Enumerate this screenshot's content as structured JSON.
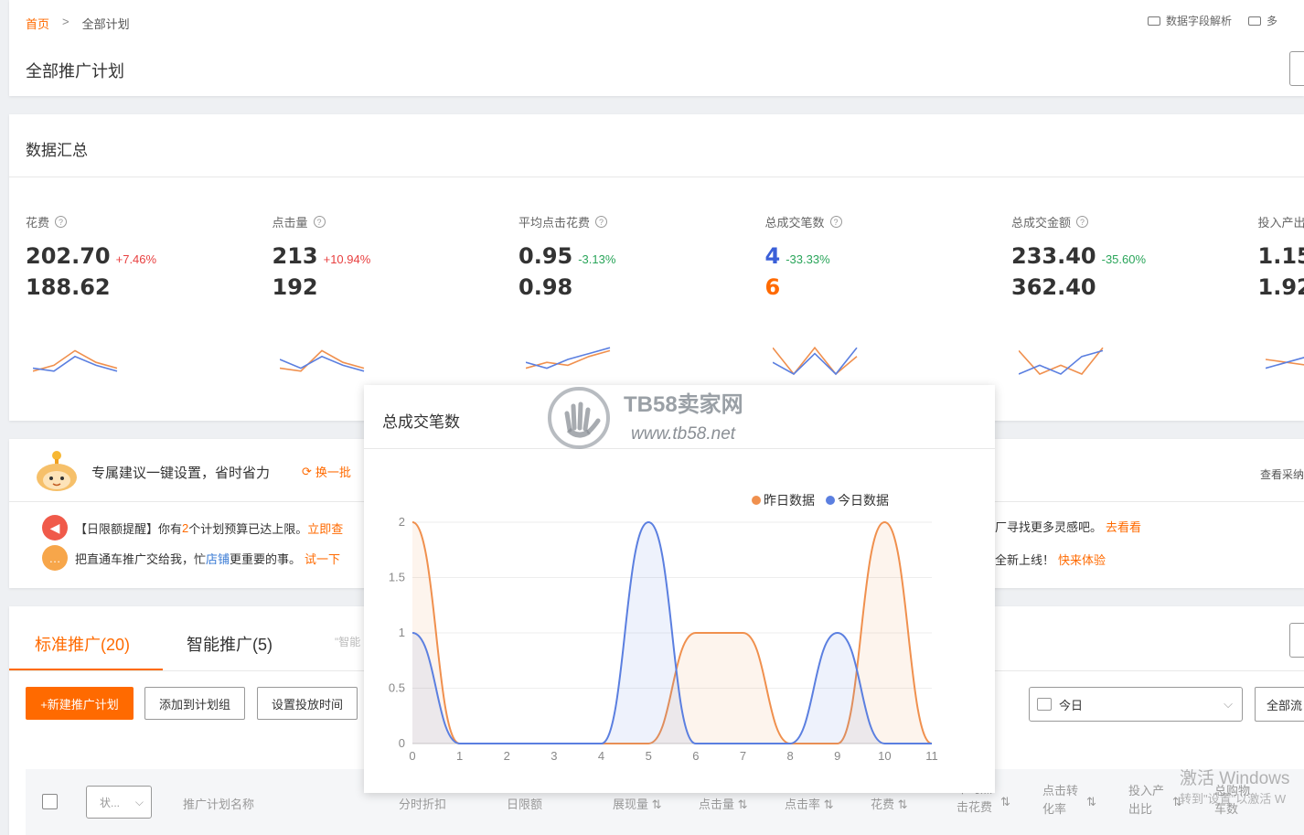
{
  "breadcrumb": {
    "home": "首页",
    "sep": ">",
    "current": "全部计划"
  },
  "top_right": {
    "field_parse": "数据字段解析",
    "multi": "多"
  },
  "page_title": "全部推广计划",
  "summary": {
    "title": "数据汇总",
    "metrics": [
      {
        "label": "花费",
        "today": "202.70",
        "change": "+7.46%",
        "dir": "up",
        "yesterday": "188.62",
        "highlight": false
      },
      {
        "label": "点击量",
        "today": "213",
        "change": "+10.94%",
        "dir": "up",
        "yesterday": "192",
        "highlight": false
      },
      {
        "label": "平均点击花费",
        "today": "0.95",
        "change": "-3.13%",
        "dir": "down",
        "yesterday": "0.98",
        "highlight": false
      },
      {
        "label": "总成交笔数",
        "today": "4",
        "change": "-33.33%",
        "dir": "down",
        "yesterday": "6",
        "highlight": true
      },
      {
        "label": "总成交金额",
        "today": "233.40",
        "change": "-35.60%",
        "dir": "down",
        "yesterday": "362.40",
        "highlight": false
      },
      {
        "label": "投入产出",
        "today": "1.15",
        "change": "",
        "dir": "",
        "yesterday": "1.92",
        "highlight": false
      }
    ]
  },
  "suggest": {
    "title": "专属建议一键设置，省时省力",
    "refresh": "换一批",
    "view_all": "查看采纳",
    "tip1_prefix": "【日限额提醒】你有",
    "tip1_count": "2",
    "tip1_suffix": "个计划预算已达上限。",
    "tip1_link": "立即查",
    "tip2_prefix": "把直通车推广交给我，忙",
    "tip2_shop": "店铺",
    "tip2_suffix": "更重要的事。",
    "tip2_link": "试一下",
    "tip3_text": "厂寻找更多灵感吧。",
    "tip3_link": "去看看",
    "tip4_text": "全新上线！",
    "tip4_link": "快来体验"
  },
  "tabs": {
    "standard": "标准推广(20)",
    "smart": "智能推广(5)",
    "smart_hint": "\"智能"
  },
  "actions": {
    "new_plan": "+新建推广计划",
    "add_group": "添加到计划组",
    "set_time": "设置投放时间",
    "date_select": "今日",
    "all_flow": "全部流"
  },
  "table_headers": {
    "status": "状...",
    "plan_name": "推广计划名称",
    "discount": "分时折扣",
    "daily_limit": "日限额",
    "impressions": "展现量",
    "clicks": "点击量",
    "ctr": "点击率",
    "cost": "花费",
    "avg_cost_a": "平均点",
    "avg_cost_b": "击花费",
    "cvr_a": "点击转",
    "cvr_b": "化率",
    "roi_a": "投入产",
    "roi_b": "出比",
    "cart_a": "总购物",
    "cart_b": "车数"
  },
  "watermark": {
    "brand": "TB58卖家网",
    "url": "www.tb58.net"
  },
  "activate": {
    "line1": "激活 Windows",
    "line2": "转到\"设置\"以激活 W"
  },
  "popup": {
    "title": "总成交笔数",
    "legend_yesterday": "昨日数据",
    "legend_today": "今日数据",
    "colors": {
      "yesterday": "#f0904e",
      "today": "#5b7fe0"
    }
  },
  "chart_data": {
    "type": "area",
    "title": "总成交笔数",
    "x": [
      0,
      1,
      2,
      3,
      4,
      5,
      6,
      7,
      8,
      9,
      10,
      11
    ],
    "ylim": [
      0,
      2
    ],
    "yticks": [
      "0",
      "0.5",
      "1",
      "1.5",
      "2"
    ],
    "grid": true,
    "legend": "top-right",
    "series": [
      {
        "name": "昨日数据",
        "values": [
          2,
          0,
          0,
          0,
          0,
          0,
          1,
          1,
          0,
          0,
          2,
          0
        ]
      },
      {
        "name": "今日数据",
        "values": [
          1,
          0,
          0,
          0,
          0,
          2,
          0,
          0,
          0,
          1,
          0,
          0
        ]
      }
    ]
  }
}
